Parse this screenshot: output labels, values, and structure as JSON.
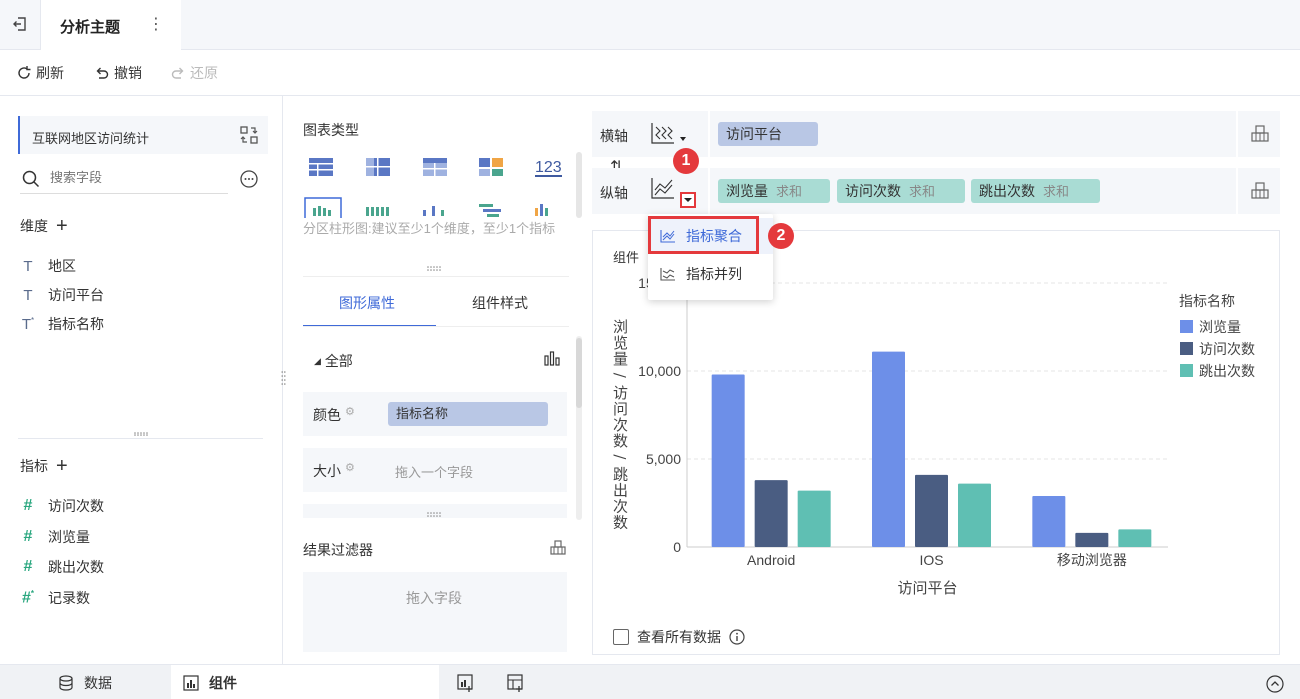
{
  "header": {
    "title": "分析主题"
  },
  "toolbar": {
    "refresh": "刷新",
    "undo": "撤销",
    "redo": "还原"
  },
  "left": {
    "dataset": "互联网地区访问统计",
    "search_placeholder": "搜索字段",
    "dimensions_title": "维度",
    "dimensions": [
      "地区",
      "访问平台",
      "指标名称"
    ],
    "measures_title": "指标",
    "measures": [
      "访问次数",
      "浏览量",
      "跳出次数",
      "记录数"
    ]
  },
  "middle": {
    "chart_type_title": "图表类型",
    "hint": "分区柱形图:建议至少1个维度，至少1个指标",
    "tabs": [
      "图形属性",
      "组件样式"
    ],
    "all_label": "全部",
    "color_label": "颜色",
    "color_field": "指标名称",
    "size_label": "大小",
    "size_placeholder": "拖入一个字段",
    "filter_title": "结果过滤器",
    "filter_placeholder": "拖入字段"
  },
  "axes": {
    "x_label": "横轴",
    "x_field": "访问平台",
    "y_label": "纵轴",
    "y_fields": [
      {
        "name": "浏览量",
        "agg": "求和"
      },
      {
        "name": "访问次数",
        "agg": "求和"
      },
      {
        "name": "跳出次数",
        "agg": "求和"
      }
    ]
  },
  "dropdown": {
    "items": [
      "指标聚合",
      "指标并列"
    ]
  },
  "badges": [
    "1",
    "2"
  ],
  "card": {
    "title": "组件",
    "view_all": "查看所有数据"
  },
  "bottom": {
    "data_tab": "数据",
    "component_tab": "组件"
  },
  "colors": {
    "accent": "#3f6ad8",
    "series1": "#6d8fe8",
    "series2": "#4a5d82",
    "series3": "#5fbfb3",
    "red": "#e4393c"
  },
  "chart_data": {
    "type": "bar",
    "title": "",
    "xlabel": "访问平台",
    "ylabel": "浏览量 / 访问次数 / 跳出次数",
    "categories": [
      "Android",
      "IOS",
      "移动浏览器"
    ],
    "series": [
      {
        "name": "浏览量",
        "values": [
          9800,
          11100,
          2900
        ]
      },
      {
        "name": "访问次数",
        "values": [
          3800,
          4100,
          800
        ]
      },
      {
        "name": "跳出次数",
        "values": [
          3200,
          3600,
          1000
        ]
      }
    ],
    "ylim": [
      0,
      15000
    ],
    "yticks": [
      "0",
      "5,000",
      "10,000",
      "15,000"
    ],
    "legend_title": "指标名称",
    "legend_position": "right",
    "grid": true
  }
}
